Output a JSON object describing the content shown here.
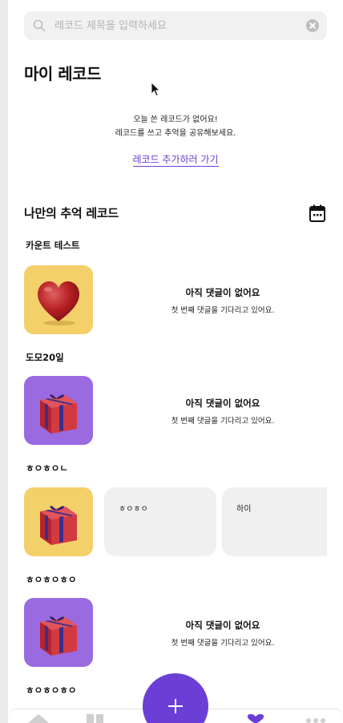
{
  "search": {
    "placeholder": "레코드 제목을 입력하세요",
    "value": ""
  },
  "page_title": "마이 레코드",
  "today_empty": {
    "line1": "오늘 쓴 레코드가 없어요!",
    "line2": "레코드를 쓰고 추억을 공유해보세요.",
    "link": "레코드 추가하러 가기"
  },
  "section_title": "나만의 추억 레코드",
  "records": [
    {
      "title": "카운트 테스트",
      "thumb": "heart-icon",
      "bg": "#f4d06a",
      "empty_title": "아직 댓글이 없어요",
      "empty_sub": "첫 번째 댓글을 기다리고 있어요."
    },
    {
      "title": "도모20일",
      "thumb": "gift-icon",
      "bg": "#9a6ae0",
      "empty_title": "아직 댓글이 없어요",
      "empty_sub": "첫 번째 댓글을 기다리고 있어요."
    },
    {
      "title": "ㅎㅇㅎㅇㄴ",
      "thumb": "gift-icon",
      "bg": "#f4d06a",
      "comments": [
        "ㅎㅇㅎㅇ",
        "하이"
      ]
    },
    {
      "title": "ㅎㅇㅎㅇㅎㅇ",
      "thumb": "gift-icon",
      "bg": "#9a6ae0",
      "empty_title": "아직 댓글이 없어요",
      "empty_sub": "첫 번째 댓글을 기다리고 있어요."
    },
    {
      "title": "ㅎㅇㅎㅇㅎㅇ"
    }
  ],
  "colors": {
    "accent": "#6b3fd6",
    "yellow": "#f4d06a",
    "purple": "#9a6ae0",
    "card": "#f0f0f0"
  },
  "nav": {
    "icons": [
      "home-icon",
      "grid-icon",
      "heart-icon",
      "more-icon"
    ],
    "fab": "plus-icon"
  }
}
